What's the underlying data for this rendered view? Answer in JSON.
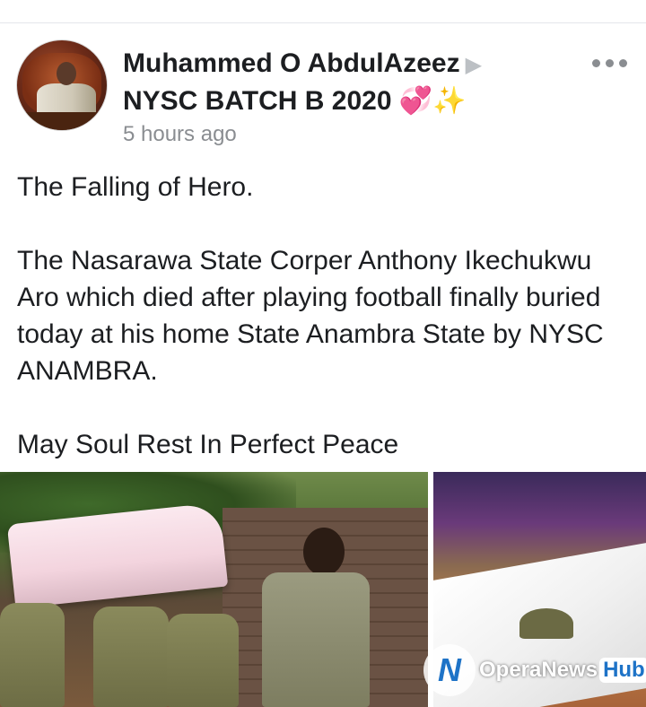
{
  "post": {
    "author": "Muhammed O AbdulAzeez",
    "author_arrow": "▶",
    "group": "NYSC BATCH B 2020",
    "group_emojis": "💞✨",
    "timestamp": "5 hours ago",
    "paragraphs": [
      "The Falling of Hero.",
      "The Nasarawa State Corper Anthony Ikechukwu Aro which died after playing football finally buried today at his home State Anambra State by NYSC ANAMBRA.",
      "May Soul Rest In Perfect Peace"
    ]
  },
  "watermark": {
    "brand": "OperaNews",
    "hub": "Hub"
  },
  "icons": {
    "more": "more-options-icon",
    "avatar": "profile-avatar"
  }
}
